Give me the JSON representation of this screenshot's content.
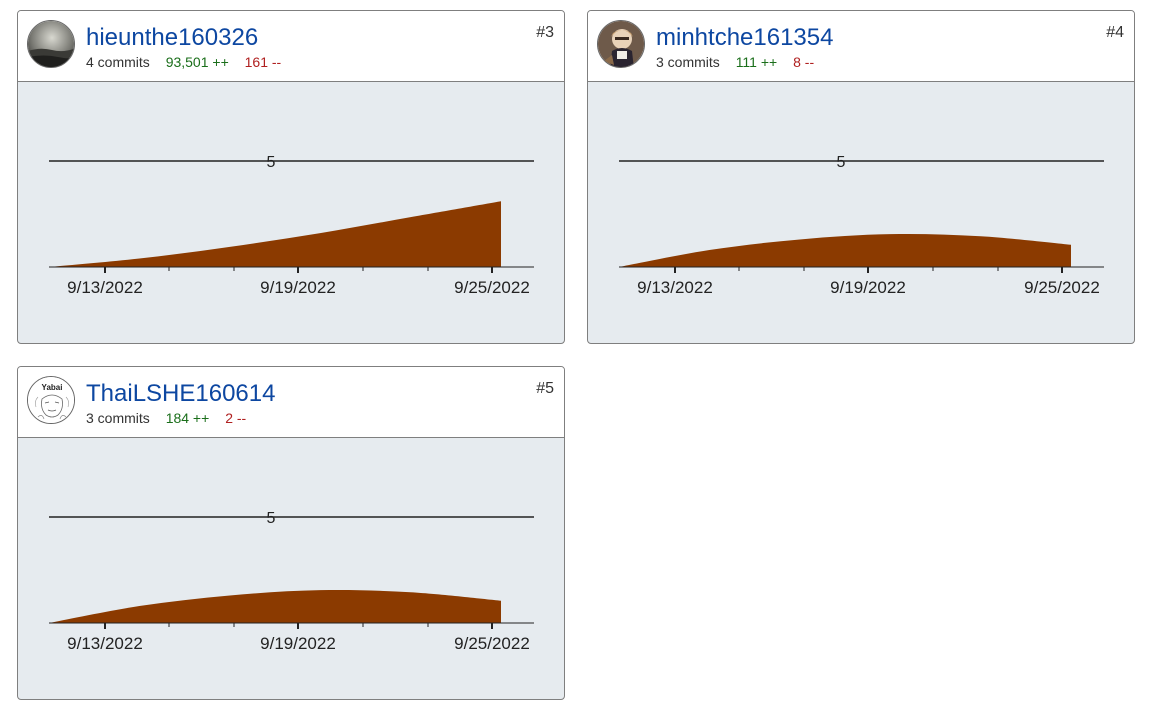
{
  "contributors": [
    {
      "username": "hieunthe160326",
      "rank": "#3",
      "commits": "4 commits",
      "additions": "93,501 ++",
      "deletions": "161 --",
      "avatar": "landscape-photo",
      "chart_data": {
        "type": "area",
        "x": [
          "9/10/2022",
          "9/13/2022",
          "9/16/2022",
          "9/19/2022",
          "9/22/2022",
          "9/25/2022"
        ],
        "values": [
          0,
          0.4,
          0.95,
          1.6,
          2.35,
          3.1
        ],
        "x_tick_labels": [
          "9/13/2022",
          "9/19/2022",
          "9/25/2022"
        ],
        "y_reference_label": "5",
        "y_reference_value": 5,
        "ylim": [
          0,
          5
        ],
        "color": "#8b3a00"
      }
    },
    {
      "username": "minhtche161354",
      "rank": "#4",
      "commits": "3 commits",
      "additions": "111 ++",
      "deletions": "8 --",
      "avatar": "anime-character",
      "chart_data": {
        "type": "area",
        "x": [
          "9/10/2022",
          "9/13/2022",
          "9/16/2022",
          "9/19/2022",
          "9/22/2022",
          "9/25/2022"
        ],
        "values": [
          0,
          0.8,
          1.3,
          1.55,
          1.45,
          1.05
        ],
        "x_tick_labels": [
          "9/13/2022",
          "9/19/2022",
          "9/25/2022"
        ],
        "y_reference_label": "5",
        "y_reference_value": 5,
        "ylim": [
          0,
          5
        ],
        "color": "#8b3a00"
      }
    },
    {
      "username": "ThaiLSHE160614",
      "rank": "#5",
      "commits": "3 commits",
      "additions": "184 ++",
      "deletions": "2 --",
      "avatar": "yabai-sketch",
      "avatar_text": "Yabai",
      "chart_data": {
        "type": "area",
        "x": [
          "9/10/2022",
          "9/13/2022",
          "9/16/2022",
          "9/19/2022",
          "9/22/2022",
          "9/25/2022"
        ],
        "values": [
          0,
          0.8,
          1.3,
          1.55,
          1.45,
          1.05
        ],
        "x_tick_labels": [
          "9/13/2022",
          "9/19/2022",
          "9/25/2022"
        ],
        "y_reference_label": "5",
        "y_reference_value": 5,
        "ylim": [
          0,
          5
        ],
        "color": "#8b3a00"
      }
    }
  ]
}
